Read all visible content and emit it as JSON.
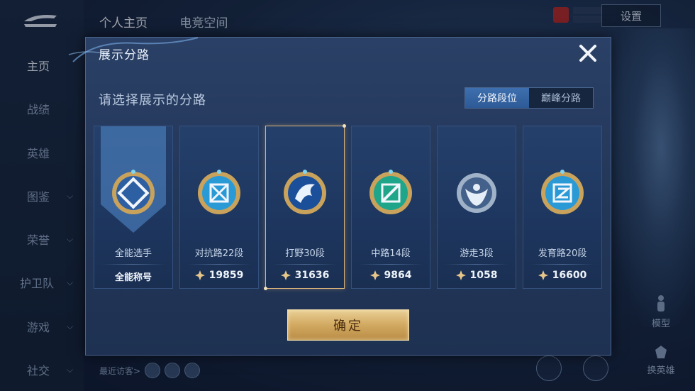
{
  "sidebar": {
    "items": [
      {
        "label": "主页",
        "has_chevron": false,
        "active": true
      },
      {
        "label": "战绩",
        "has_chevron": false
      },
      {
        "label": "英雄",
        "has_chevron": false
      },
      {
        "label": "图鉴",
        "has_chevron": true
      },
      {
        "label": "荣誉",
        "has_chevron": true
      },
      {
        "label": "护卫队",
        "has_chevron": true
      },
      {
        "label": "游戏",
        "has_chevron": true
      },
      {
        "label": "社交",
        "has_chevron": true
      }
    ]
  },
  "header": {
    "tabs": [
      "个人主页",
      "电竞空间"
    ],
    "settings_label": "设置"
  },
  "right_panel": {
    "model_label": "模型",
    "switch_hero_label": "换英雄"
  },
  "footer": {
    "recent_visitors_label": "最近访客>"
  },
  "dialog": {
    "title": "展示分路",
    "subtitle": "请选择展示的分路",
    "segments": [
      {
        "label": "分路段位",
        "active": true
      },
      {
        "label": "巅峰分路",
        "active": false
      }
    ],
    "cards": [
      {
        "name": "全能选手",
        "title": "全能称号",
        "emblem": "all-round-emblem-icon",
        "selected": false
      },
      {
        "name": "对抗路22段",
        "score": "19859",
        "emblem": "clash-lane-emblem-icon",
        "selected": false
      },
      {
        "name": "打野30段",
        "score": "31636",
        "emblem": "jungle-emblem-icon",
        "selected": true
      },
      {
        "name": "中路14段",
        "score": "9864",
        "emblem": "mid-lane-emblem-icon",
        "selected": false
      },
      {
        "name": "游走3段",
        "score": "1058",
        "emblem": "roam-emblem-icon",
        "selected": false
      },
      {
        "name": "发育路20段",
        "score": "16600",
        "emblem": "farm-lane-emblem-icon",
        "selected": false
      }
    ],
    "confirm_label": "确定"
  },
  "colors": {
    "accent_gold": "#d2a961",
    "selected_border": "#d8b27a",
    "segment_active": "#3e6fae"
  }
}
